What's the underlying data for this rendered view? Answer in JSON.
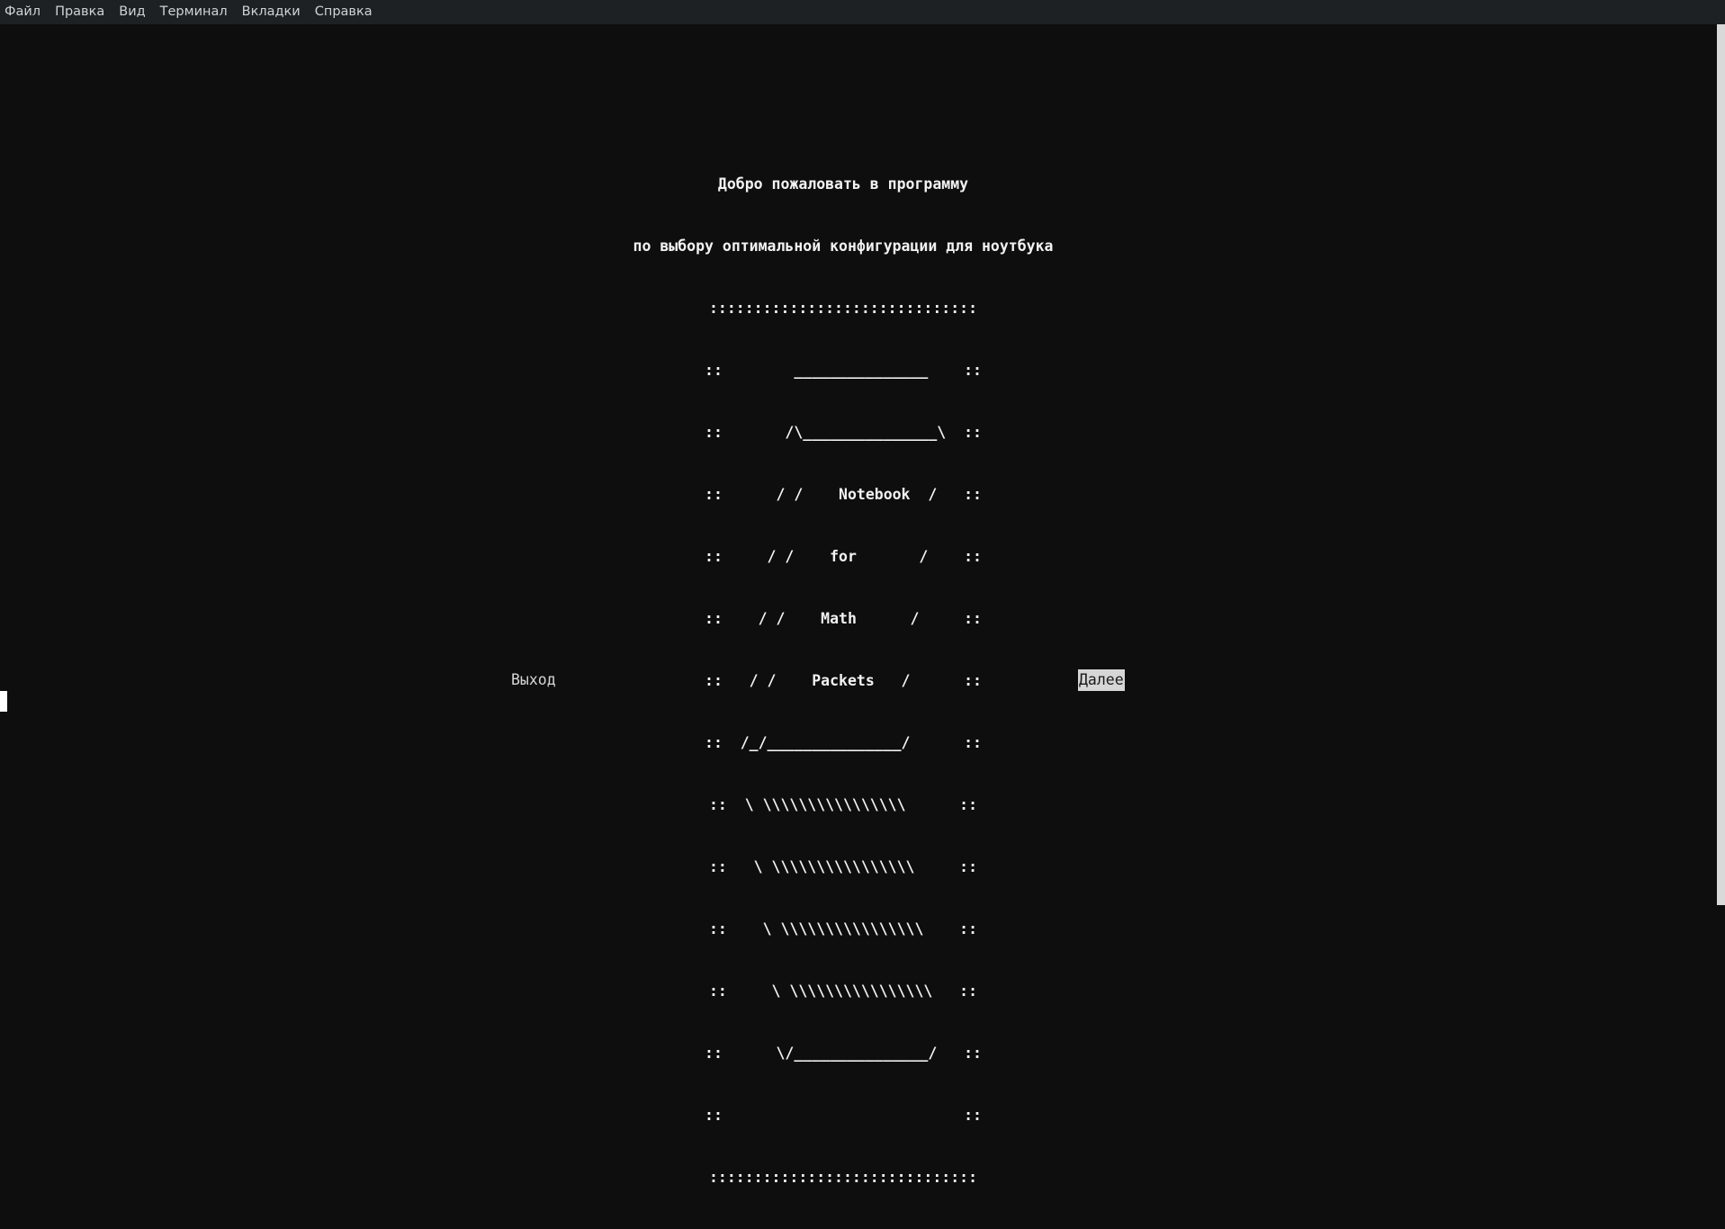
{
  "menubar": {
    "items": [
      "Файл",
      "Правка",
      "Вид",
      "Терминал",
      "Вкладки",
      "Справка"
    ]
  },
  "banner": {
    "title_line1": "Добро пожаловать в программу",
    "title_line2": "по выбору оптимальной конфигурации для ноутбука",
    "art": [
      "::::::::::::::::::::::::::::::",
      "::        _______________    ::",
      "::       /\\_______________\\  ::",
      "::      / /    Notebook  /   ::",
      "::     / /    for       /    ::",
      "::    / /    Math      /     ::",
      "::   / /    Packets   /      ::",
      "::  /_/_______________/      ::",
      "::  \\ \\\\\\\\\\\\\\\\\\\\\\\\\\\\\\\\      ::",
      "::   \\ \\\\\\\\\\\\\\\\\\\\\\\\\\\\\\\\     ::",
      "::    \\ \\\\\\\\\\\\\\\\\\\\\\\\\\\\\\\\    ::",
      "::     \\ \\\\\\\\\\\\\\\\\\\\\\\\\\\\\\\\   ::",
      "::      \\/_______________/   ::",
      "::                           ::",
      "::::::::::::::::::::::::::::::"
    ]
  },
  "dialog": {
    "exit_label": "Выход",
    "next_label": "Далее"
  }
}
